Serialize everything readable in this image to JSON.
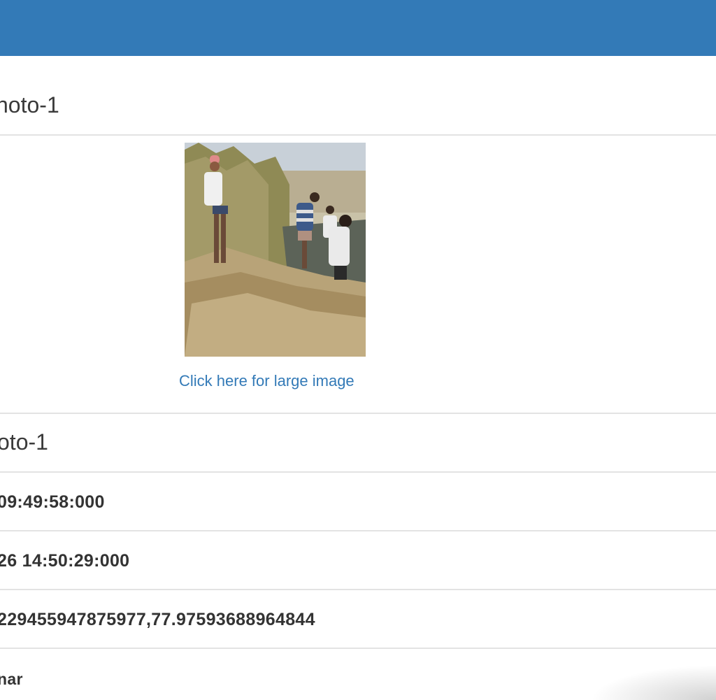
{
  "header": {
    "color": "#337ab7"
  },
  "section1": {
    "title": "noto-1"
  },
  "photo": {
    "icon": "landscape-photo",
    "link_label": "Click here for large image"
  },
  "section2": {
    "title": "oto-1"
  },
  "fields": [
    {
      "value": "09:49:58:000"
    },
    {
      "value": "26 14:50:29:000"
    },
    {
      "value": "229455947875977,77.97593688964844"
    },
    {
      "value": "nar"
    }
  ]
}
